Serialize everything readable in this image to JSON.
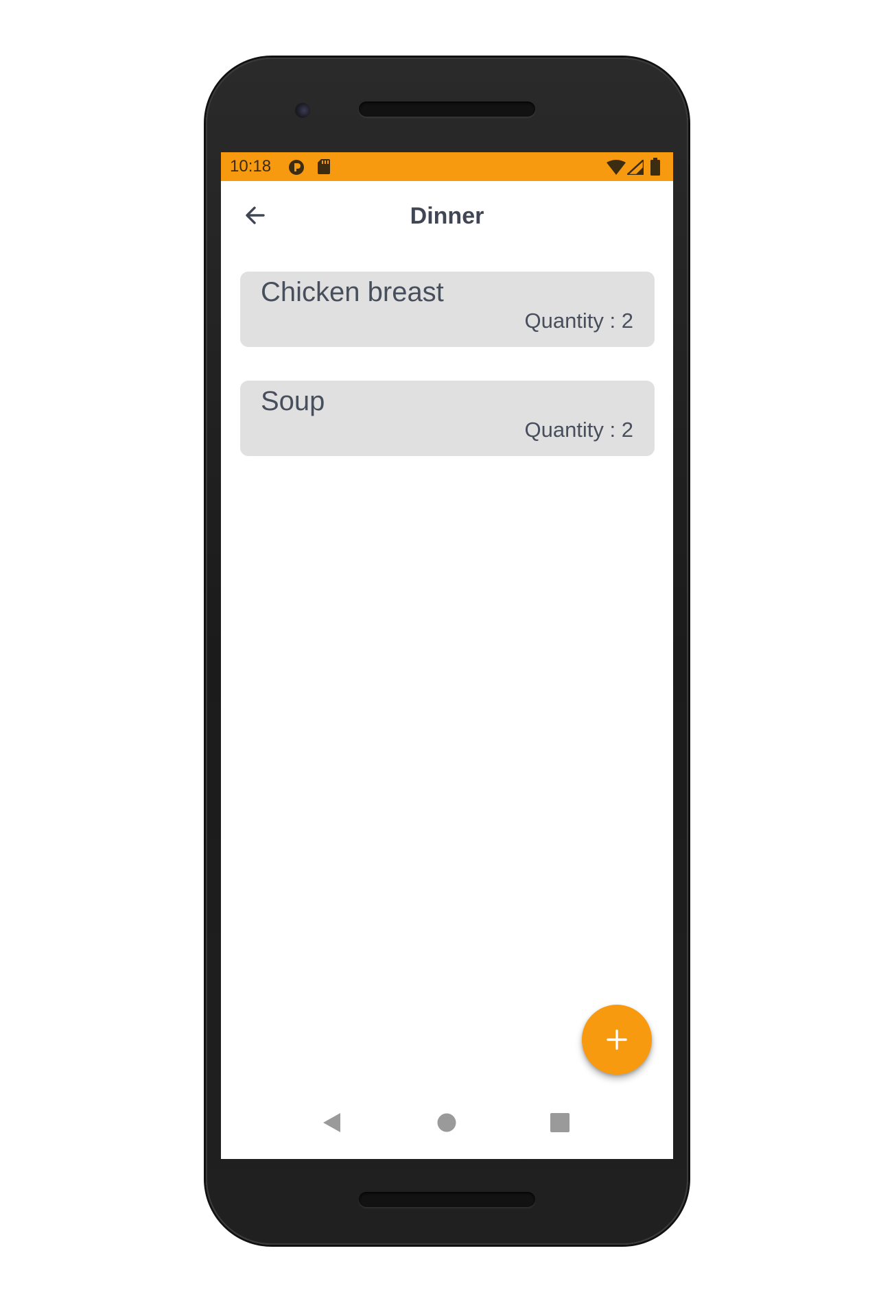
{
  "status_bar": {
    "time": "10:18",
    "color": "#f79a10",
    "left_icons": [
      "play-protect-icon",
      "sd-card-icon"
    ],
    "right_icons": [
      "wifi-icon",
      "cellular-signal-icon",
      "battery-icon"
    ]
  },
  "app_bar": {
    "title": "Dinner",
    "back_icon": "arrow-back-icon"
  },
  "items": [
    {
      "name": "Chicken breast",
      "quantity_text": "Quantity : 2"
    },
    {
      "name": "Soup",
      "quantity_text": "Quantity : 2"
    }
  ],
  "fab": {
    "icon": "plus-icon",
    "color": "#f89a10"
  },
  "nav_bar": {
    "icons": [
      "nav-back-icon",
      "nav-home-icon",
      "nav-recents-icon"
    ]
  }
}
